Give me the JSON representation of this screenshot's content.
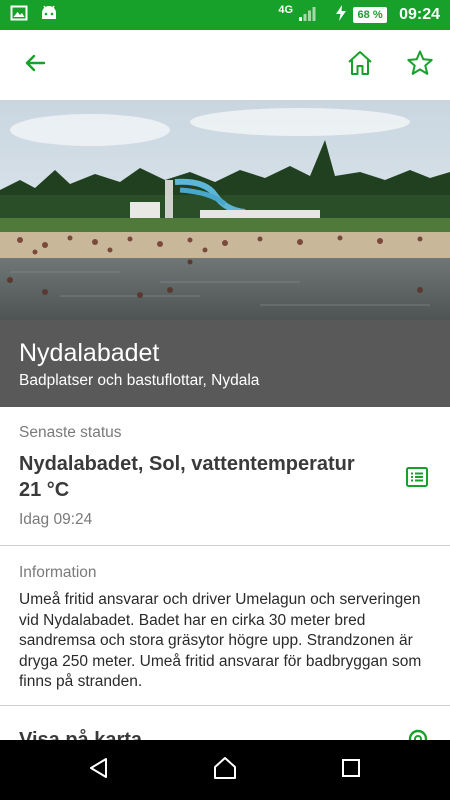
{
  "status_bar": {
    "network": "4G",
    "battery": "68 %",
    "time": "09:24"
  },
  "app_bar": {
    "back_icon": "arrow-left-icon",
    "home_icon": "home-icon",
    "favorite_icon": "star-outline-icon",
    "accent_color": "#17a12a"
  },
  "place": {
    "name": "Nydalabadet",
    "subtitle": "Badplatser och bastuflottar, Nydala"
  },
  "latest_status": {
    "label": "Senaste status",
    "title": "Nydalabadet, Sol, vattentemperatur 21 °C",
    "time": "Idag 09:24",
    "icon": "list-icon"
  },
  "information": {
    "label": "Information",
    "text": "Umeå fritid ansvarar och driver Umelagun och serveringen vid Nydalabadet. Badet har en cirka 30 meter bred sandremsa och stora gräsytor högre upp. Strandzonen är dryga 250 meter. Umeå fritid ansvarar för badbryggan som finns på stranden."
  },
  "map_section": {
    "title": "Visa på karta",
    "icon": "map-pin-icon"
  },
  "nav_bar": {
    "back": "triangle-back-icon",
    "home": "circle-home-icon",
    "recents": "square-recents-icon"
  }
}
